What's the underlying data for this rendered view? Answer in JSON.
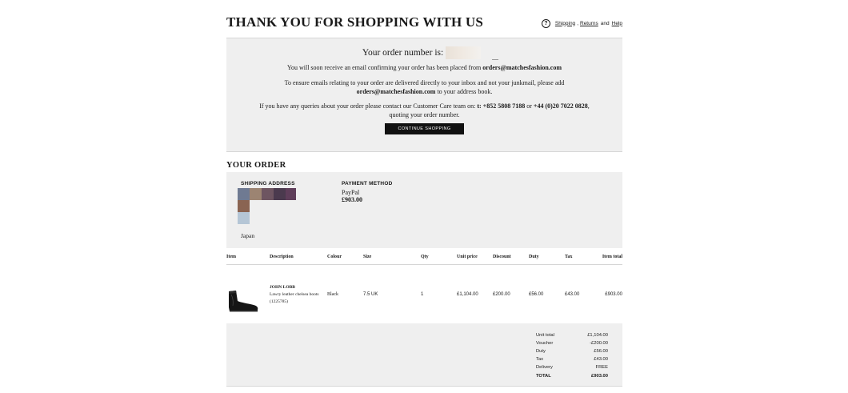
{
  "header": {
    "title": "THANK YOU FOR SHOPPING WITH US",
    "help_icon": "question-circle-icon",
    "help_q": "?",
    "shipping_link": "Shipping",
    "comma": ",",
    "returns_link": "Returns",
    "and_text": "and",
    "help_link": "Help"
  },
  "confirmation": {
    "order_number_label": "Your order number is:",
    "p1_text": "You will soon receive an email confirming your order has been placed from ",
    "p1_email": "orders@matchesfashion.com",
    "p2_text": "To ensure emails relating to your order are delivered directly to your inbox and not your junkmail, please add ",
    "p2_email": "orders@matchesfashion.com",
    "p2_tail": " to your address book.",
    "p3_text": "If you have any queries about your order please contact our Customer Care team on: ",
    "p3_phone1": "t: +852 5808 7188",
    "p3_or": " or ",
    "p3_phone2": "+44 (0)20 7022 0828",
    "p3_tail": ", quoting your order number.",
    "continue_button": "CONTINUE SHOPPING"
  },
  "your_order": {
    "title": "YOUR ORDER",
    "shipping_address_label": "SHIPPING ADDRESS",
    "country": "Japan",
    "payment_method_label": "PAYMENT METHOD",
    "payment_method": "PayPal",
    "payment_amount": "£903.00",
    "redaction_colors": [
      "#6f7a92",
      "#9c8472",
      "#6e5561",
      "#4b3a4e",
      "#5f3e5a",
      "#8a6452",
      "#b5c6d6"
    ]
  },
  "table": {
    "headers": [
      "Item",
      "Description",
      "Colour",
      "Size",
      "Qty",
      "Unit price",
      "Discount",
      "Duty",
      "Tax",
      "Item total"
    ],
    "row": {
      "image_icon": "chelsea-boot-image",
      "brand": "JOHN LOBB",
      "description": "Lawry leather chelsea boots",
      "code": "(1225785)",
      "colour": "Black",
      "size": "7.5 UK",
      "qty": "1",
      "unit_price": "£1,104.00",
      "discount": "£200.00",
      "duty": "£56.00",
      "tax": "£43.00",
      "item_total": "£903.00"
    }
  },
  "totals": {
    "unit_total_label": "Unit total",
    "unit_total": "£1,104.00",
    "voucher_label": "Voucher",
    "voucher": "-£200.00",
    "duty_label": "Duty",
    "duty": "£56.00",
    "tax_label": "Tax",
    "tax": "£43.00",
    "delivery_label": "Delivery",
    "delivery": "FREE",
    "total_label": "TOTAL",
    "total": "£903.00"
  }
}
